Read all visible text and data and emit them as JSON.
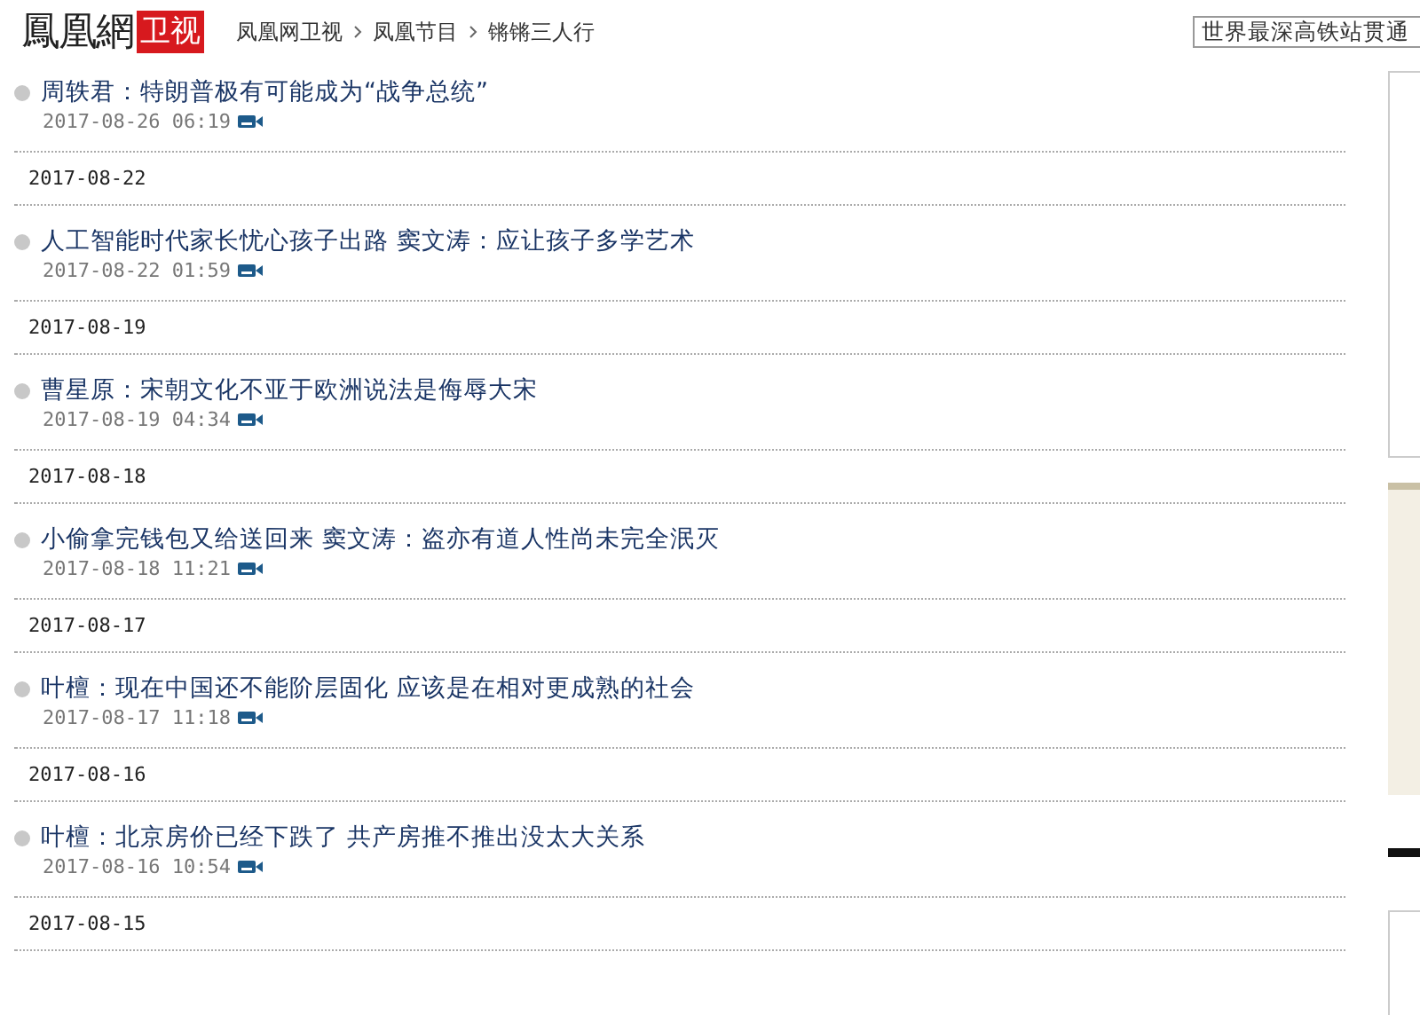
{
  "header": {
    "logo": "鳳凰網",
    "logo_badge": "卫视",
    "breadcrumb": [
      "凤凰网卫视",
      "凤凰节目",
      "锵锵三人行"
    ],
    "search": {
      "value": "世界最深高铁站贯通"
    }
  },
  "feed": [
    {
      "kind": "item",
      "title": "周轶君：特朗普极有可能成为“战争总统”",
      "time": "2017-08-26 06:19"
    },
    {
      "kind": "date",
      "text": "2017-08-22"
    },
    {
      "kind": "item",
      "title": "人工智能时代家长忧心孩子出路 窦文涛：应让孩子多学艺术",
      "time": "2017-08-22 01:59"
    },
    {
      "kind": "date",
      "text": "2017-08-19"
    },
    {
      "kind": "item",
      "title": "曹星原：宋朝文化不亚于欧洲说法是侮辱大宋",
      "time": "2017-08-19 04:34"
    },
    {
      "kind": "date",
      "text": "2017-08-18"
    },
    {
      "kind": "item",
      "title": "小偷拿完钱包又给送回来 窦文涛：盗亦有道人性尚未完全泯灭",
      "time": "2017-08-18 11:21"
    },
    {
      "kind": "date",
      "text": "2017-08-17"
    },
    {
      "kind": "item",
      "title": "叶檀：现在中国还不能阶层固化 应该是在相对更成熟的社会",
      "time": "2017-08-17 11:18"
    },
    {
      "kind": "date",
      "text": "2017-08-16"
    },
    {
      "kind": "item",
      "title": "叶檀：北京房价已经下跌了 共产房推不推出没太大关系",
      "time": "2017-08-16 10:54"
    },
    {
      "kind": "date",
      "text": "2017-08-15"
    }
  ]
}
